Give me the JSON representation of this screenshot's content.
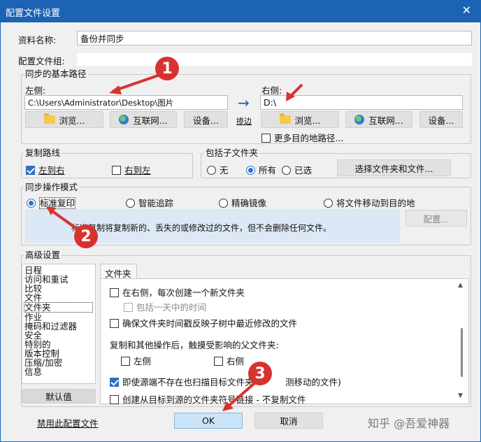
{
  "window": {
    "title": "配置文件设置"
  },
  "profile": {
    "name_label": "资料名称:",
    "name_value": "备份并同步",
    "group_label": "配置文件组:"
  },
  "paths": {
    "group_title": "同步的基本路径",
    "left_label": "左侧:",
    "left_value": "C:\\Users\\Administrator\\Desktop\\图片",
    "right_label": "右侧:",
    "right_value": "D:\\",
    "arrow": "→",
    "swap_label": "掺边",
    "browse_label": "浏览...",
    "internet_label": "互联网...",
    "device_label": "设备...",
    "more_destinations_label": "更多目的地路径..."
  },
  "copy_route": {
    "group_title": "复制路线",
    "left_to_right": "左到右",
    "right_to_left": "右到左"
  },
  "subfolders": {
    "group_title": "包括子文件夹",
    "none": "无",
    "all": "所有",
    "selected": "已选",
    "select_button": "选择文件夹和文件..."
  },
  "sync_mode": {
    "group_title": "同步操作模式",
    "options": [
      "标准复印",
      "智能追踪",
      "精确镜像",
      "将文件移动到目的地"
    ],
    "description": "标准复制将复制新的、丢失的或修改过的文件，但不会删除任何文件。",
    "config_button": "配置..."
  },
  "advanced": {
    "group_title": "高级设置",
    "list": [
      "日程",
      "访问和重试",
      "比较",
      "文件",
      "文件夹",
      "作业",
      "掩码和过滤器",
      "安全",
      "特别的",
      "版本控制",
      "压缩/加密",
      "信息"
    ],
    "defaults_button": "默认值",
    "tab_label": "文件夹",
    "opt1": "在右侧，每次创建一个新文件夹",
    "opt1_sub": "包括一天中的时间",
    "opt2": "确保文件夹时间戳反映子树中最近修改的文件",
    "touch_label": "复制和其他操作后，触摸受影响的父文件夹:",
    "touch_left": "左侧",
    "touch_right": "右侧",
    "opt3": "即使源端不存在也扫描目标文件夹",
    "opt3_tail": "测移动的文件)",
    "opt4": "创建从目标到源的文件夹符号链接 - 不复制文件"
  },
  "footer": {
    "disable_link": "禁用此配置文件",
    "ok": "OK",
    "cancel": "取消",
    "watermark": "知乎 @吾爱神器"
  },
  "annotations": {
    "m1": "1",
    "m2": "2",
    "m3": "3"
  },
  "colors": {
    "title_bar": "#1c63b4",
    "marker": "#d8322e",
    "accent": "#2f6fc4"
  }
}
